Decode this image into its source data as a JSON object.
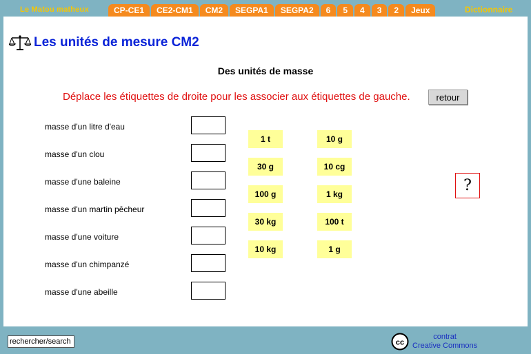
{
  "nav": {
    "brand": "Le Matou matheux",
    "tabs": [
      "CP-CE1",
      "CE2-CM1",
      "CM2",
      "SEGPA1",
      "SEGPA2",
      "6",
      "5",
      "4",
      "3",
      "2",
      "Jeux"
    ],
    "dictionary": "Dictionnaire"
  },
  "page": {
    "title": "Les unités de mesure CM2",
    "subtitle": "Des unités de masse",
    "instruction": "Déplace les étiquettes de droite pour les associer aux étiquettes de gauche.",
    "back_label": "retour",
    "help_symbol": "?"
  },
  "left_labels": [
    "masse d'un litre d'eau",
    "masse d'un clou",
    "masse d'une baleine",
    "masse d'un martin pêcheur",
    "masse d'une voiture",
    "masse d'un chimpanzé",
    "masse d'une abeille"
  ],
  "tags_col1": [
    "1 t",
    "30 g",
    "100 g",
    "30 kg",
    "10 kg"
  ],
  "tags_col2": [
    "10 g",
    "10 cg",
    "1 kg",
    "100 t",
    "1 g"
  ],
  "footer": {
    "search_value": "rechercher/search",
    "cc_line1": "contrat",
    "cc_line2": "Creative Commons",
    "cc_icon": "cc"
  },
  "colors": {
    "background": "#7fb3c2",
    "tab": "#f58a1e",
    "brand": "#f7c600",
    "title": "#0a23d8",
    "instruction": "#e01010",
    "tag": "#ffff99"
  }
}
